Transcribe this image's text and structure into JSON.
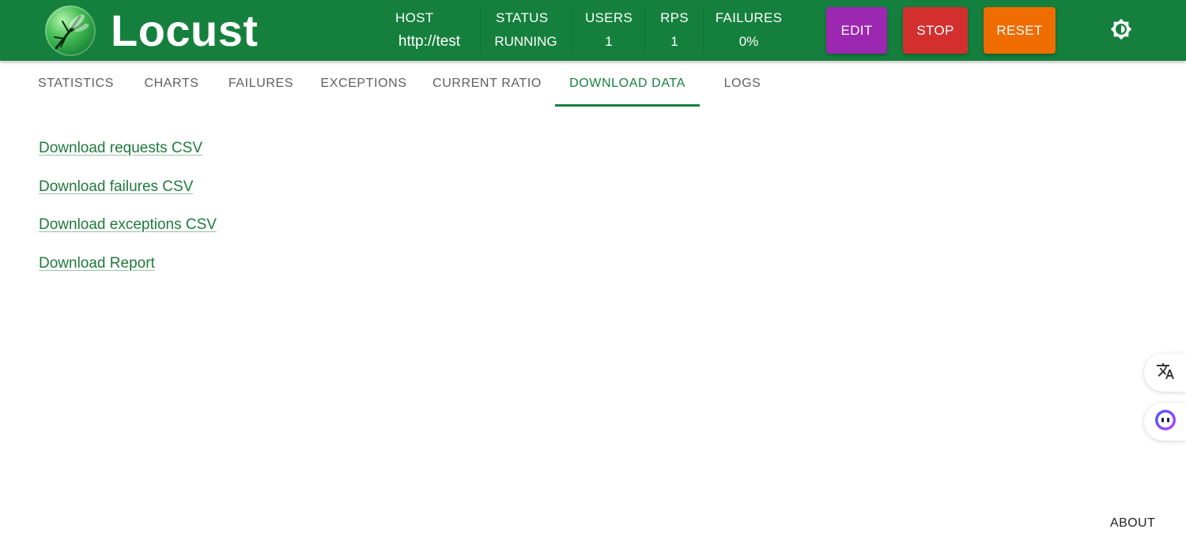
{
  "app": {
    "brand": "Locust",
    "logo_icon": "locust-logo-icon",
    "header_color": "#15803d"
  },
  "stats": {
    "host": {
      "label": "HOST",
      "value": "http://test"
    },
    "status": {
      "label": "STATUS",
      "value": "RUNNING"
    },
    "users": {
      "label": "USERS",
      "value": "1"
    },
    "rps": {
      "label": "RPS",
      "value": "1"
    },
    "failures": {
      "label": "FAILURES",
      "value": "0%"
    }
  },
  "actions": {
    "edit_label": "EDIT",
    "edit_color": "#9c27b0",
    "stop_label": "STOP",
    "stop_color": "#d32f2f",
    "reset_label": "RESET",
    "reset_color": "#ef6c00",
    "theme_toggle_icon": "brightness-icon"
  },
  "tabs": [
    {
      "label": "STATISTICS",
      "active": false
    },
    {
      "label": "CHARTS",
      "active": false
    },
    {
      "label": "FAILURES",
      "active": false
    },
    {
      "label": "EXCEPTIONS",
      "active": false
    },
    {
      "label": "CURRENT RATIO",
      "active": false
    },
    {
      "label": "DOWNLOAD DATA",
      "active": true
    },
    {
      "label": "LOGS",
      "active": false
    }
  ],
  "downloads": [
    {
      "label": "Download requests CSV"
    },
    {
      "label": "Download failures CSV"
    },
    {
      "label": "Download exceptions CSV"
    },
    {
      "label": "Download Report"
    }
  ],
  "floating": {
    "translate_icon": "translate-icon",
    "assistant_icon": "assistant-icon"
  },
  "footer": {
    "about_label": "ABOUT"
  }
}
